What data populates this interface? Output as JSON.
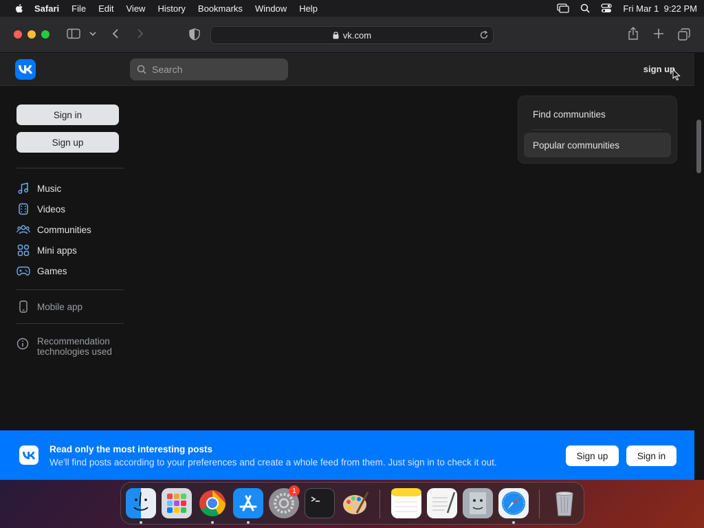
{
  "menubar": {
    "app": "Safari",
    "items": [
      "File",
      "Edit",
      "View",
      "History",
      "Bookmarks",
      "Window",
      "Help"
    ],
    "clock": "Fri Mar 1  9:22 PM"
  },
  "browser": {
    "url": "vk.com"
  },
  "header": {
    "search_placeholder": "Search",
    "signup_link": "sign up"
  },
  "sidebar": {
    "signin_label": "Sign in",
    "signup_label": "Sign up",
    "nav": [
      {
        "label": "Music",
        "icon": "music-icon"
      },
      {
        "label": "Videos",
        "icon": "video-icon"
      },
      {
        "label": "Communities",
        "icon": "communities-icon"
      },
      {
        "label": "Mini apps",
        "icon": "mini-apps-icon"
      },
      {
        "label": "Games",
        "icon": "gamepad-icon"
      }
    ],
    "mobile_app": "Mobile app",
    "recommendation": "Recommendation technologies used"
  },
  "communities_card": {
    "items": [
      "Find communities",
      "Popular communities"
    ],
    "active": "Popular communities"
  },
  "banner": {
    "title": "Read only the most interesting posts",
    "subtitle": "We'll find posts according to your preferences and create a whole feed from them. Just sign in to check it out.",
    "signup_label": "Sign up",
    "signin_label": "Sign in"
  },
  "dock": {
    "apps": [
      "Finder",
      "Launchpad",
      "Chrome",
      "App Store",
      "System Settings",
      "Terminal",
      "Paintbrush",
      "Notes",
      "TextEdit",
      "Migration Assistant",
      "Safari",
      "Trash"
    ],
    "settings_badge": "1"
  },
  "colors": {
    "vk_blue": "#0077ff",
    "page_bg": "#141414",
    "header_bg": "#222222"
  }
}
